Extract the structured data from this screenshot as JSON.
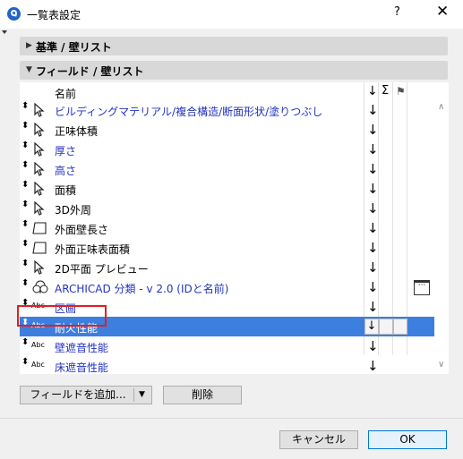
{
  "window": {
    "title": "一覧表設定",
    "help": "?",
    "close": "✕"
  },
  "sections": {
    "criteria": "基準 /  壁リスト",
    "fields": "フィールド /  壁リスト"
  },
  "table": {
    "header": {
      "name": "名前",
      "col1": "↓",
      "col2": "Σ",
      "col3": "⚑"
    },
    "rows": [
      {
        "label": "ビルディングマテリアル/複合構造/断面形状/塗りつぶし",
        "icon": "cursor-icon",
        "blue": true
      },
      {
        "label": "正味体積",
        "icon": "cursor-icon",
        "blue": false
      },
      {
        "label": "厚さ",
        "icon": "cursor-icon",
        "blue": true
      },
      {
        "label": "高さ",
        "icon": "cursor-icon",
        "blue": true
      },
      {
        "label": "面積",
        "icon": "cursor-icon",
        "blue": false
      },
      {
        "label": "3D外周",
        "icon": "cursor-icon",
        "blue": false
      },
      {
        "label": "外面壁長さ",
        "icon": "surface-icon",
        "blue": false
      },
      {
        "label": "外面正味表面積",
        "icon": "surface-icon",
        "blue": false
      },
      {
        "label": "2D平面 プレビュー",
        "icon": "cursor-icon",
        "blue": false
      },
      {
        "label": "ARCHICAD 分類 - v 2.0 (IDと名前)",
        "icon": "classification-icon",
        "blue": true
      },
      {
        "label": "区画",
        "icon": "abc-icon",
        "blue": true
      },
      {
        "label": "耐火性能",
        "icon": "abc-icon",
        "blue": false,
        "selected": true
      },
      {
        "label": "壁遮音性能",
        "icon": "abc-icon",
        "blue": true
      },
      {
        "label": "床遮音性能",
        "icon": "abc-icon",
        "blue": true
      }
    ],
    "sort_arrow": "↓",
    "abc_text": "Abc",
    "drag_glyph": "⬍",
    "dots": "···"
  },
  "buttons": {
    "add_field": "フィールドを追加...",
    "add_field_dropdown": "▼",
    "delete": "削除",
    "cancel": "キャンセル",
    "ok": "OK"
  },
  "colors": {
    "selection": "#3c7fde",
    "link_text": "#2233c0",
    "highlight_box": "#e02020"
  }
}
